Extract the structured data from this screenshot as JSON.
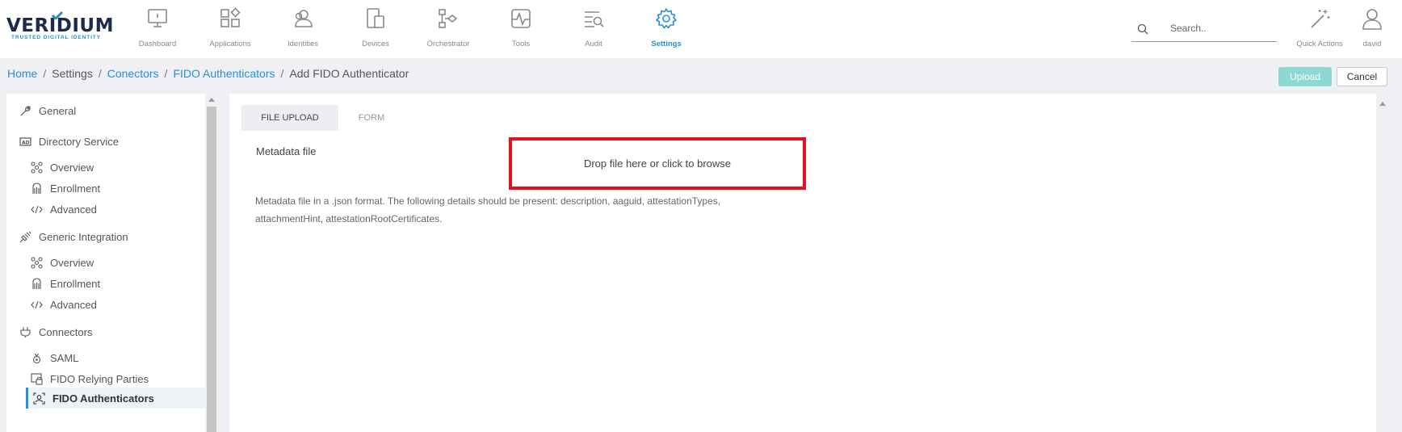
{
  "brand": {
    "name": "VERIDIUM",
    "tagline": "TRUSTED DIGITAL IDENTITY"
  },
  "nav": [
    {
      "label": "Dashboard",
      "icon": "monitor-icon"
    },
    {
      "label": "Applications",
      "icon": "apps-grid-icon"
    },
    {
      "label": "Identities",
      "icon": "users-icon"
    },
    {
      "label": "Devices",
      "icon": "devices-icon"
    },
    {
      "label": "Orchestrator",
      "icon": "orchestrator-icon"
    },
    {
      "label": "Tools",
      "icon": "pulse-icon"
    },
    {
      "label": "Audit",
      "icon": "audit-list-icon"
    },
    {
      "label": "Settings",
      "icon": "gear-icon",
      "active": true
    }
  ],
  "search": {
    "placeholder": "Search.."
  },
  "quick_actions": {
    "label": "Quick Actions",
    "icon": "magic-wand-icon"
  },
  "user": {
    "label": "david",
    "icon": "user-icon"
  },
  "breadcrumb": {
    "home": "Home",
    "settings": "Settings",
    "conectors": "Conectors",
    "fido_authenticators": "FIDO Authenticators",
    "current": "Add FIDO Authenticator",
    "separator": "/"
  },
  "actions": {
    "upload": "Upload",
    "cancel": "Cancel"
  },
  "sidebar": {
    "general": "General",
    "directory_service": "Directory Service",
    "ds_overview": "Overview",
    "ds_enrollment": "Enrollment",
    "ds_advanced": "Advanced",
    "generic_integration": "Generic Integration",
    "gi_overview": "Overview",
    "gi_enrollment": "Enrollment",
    "gi_advanced": "Advanced",
    "connectors": "Connectors",
    "saml": "SAML",
    "fido_relying_parties": "FIDO Relying Parties",
    "fido_authenticators": "FIDO Authenticators"
  },
  "tabs": {
    "file_upload": "FILE UPLOAD",
    "form": "FORM"
  },
  "form": {
    "metadata_label": "Metadata file",
    "dropzone_text": "Drop file here or click to browse",
    "help_text": "Metadata file in a .json format. The following details should be present: description, aaguid, attestationTypes, attachmentHint, attestationRootCertificates."
  },
  "colors": {
    "accent": "#2a8fd0",
    "upload_button": "#8dd9d2",
    "highlight_border": "#e0141e"
  }
}
